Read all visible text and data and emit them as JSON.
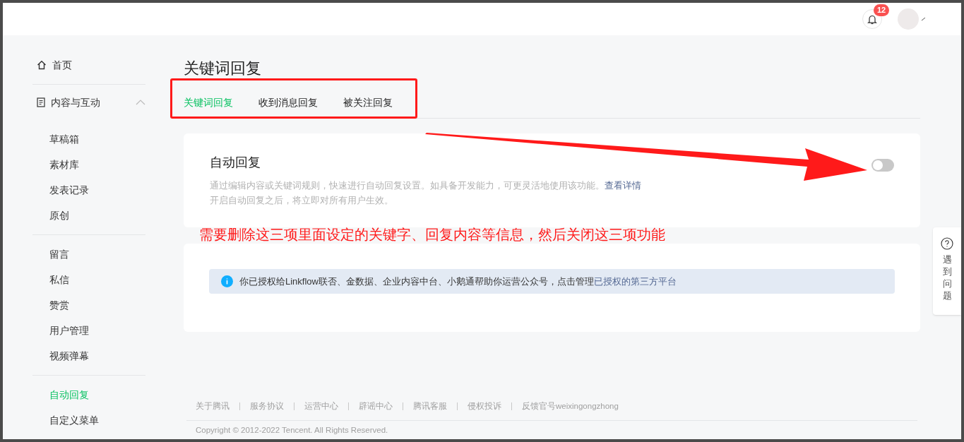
{
  "topbar": {
    "notifications": {
      "count": "12"
    }
  },
  "sidebar": {
    "home": {
      "label": "首页",
      "selected": false
    },
    "section": {
      "label": "内容与互动",
      "expanded": true,
      "groups": [
        [
          {
            "label": "草稿箱",
            "selected": false
          },
          {
            "label": "素材库",
            "selected": false
          },
          {
            "label": "发表记录",
            "selected": false
          },
          {
            "label": "原创",
            "selected": false
          }
        ],
        [
          {
            "label": "留言",
            "selected": false
          },
          {
            "label": "私信",
            "selected": false
          },
          {
            "label": "赞赏",
            "selected": false
          },
          {
            "label": "用户管理",
            "selected": false
          },
          {
            "label": "视频弹幕",
            "selected": false
          }
        ],
        [
          {
            "label": "自动回复",
            "selected": true
          },
          {
            "label": "自定义菜单",
            "selected": false
          }
        ]
      ]
    }
  },
  "page": {
    "title": "关键词回复",
    "tabs": [
      {
        "label": "关键词回复",
        "selected": true
      },
      {
        "label": "收到消息回复",
        "selected": false
      },
      {
        "label": "被关注回复",
        "selected": false
      }
    ]
  },
  "auto_reply": {
    "title": "自动回复",
    "description": "通过编辑内容或关键词规则，快速进行自动回复设置。如具备开发能力，可更灵活地使用该功能。",
    "link": "查看详情",
    "note": "开启自动回复之后，将立即对所有用户生效。",
    "on": false
  },
  "notice": {
    "text": "你已授权给Linkflow联否、金数据、企业内容中台、小鹅通帮助你运营公众号，点击管理",
    "link": "已授权的第三方平台"
  },
  "footer": {
    "links": [
      "关于腾讯",
      "服务协议",
      "运营中心",
      "辟谣中心",
      "腾讯客服",
      "侵权投诉",
      "反馈官号weixingongzhong"
    ],
    "copyright": "Copyright © 2012-2022 Tencent. All Rights Reserved."
  },
  "help_tab": {
    "label": "遇到问题"
  },
  "annotation": {
    "text": "需要删除这三项里面设定的关键字、回复内容等信息，然后关闭这三项功能"
  }
}
